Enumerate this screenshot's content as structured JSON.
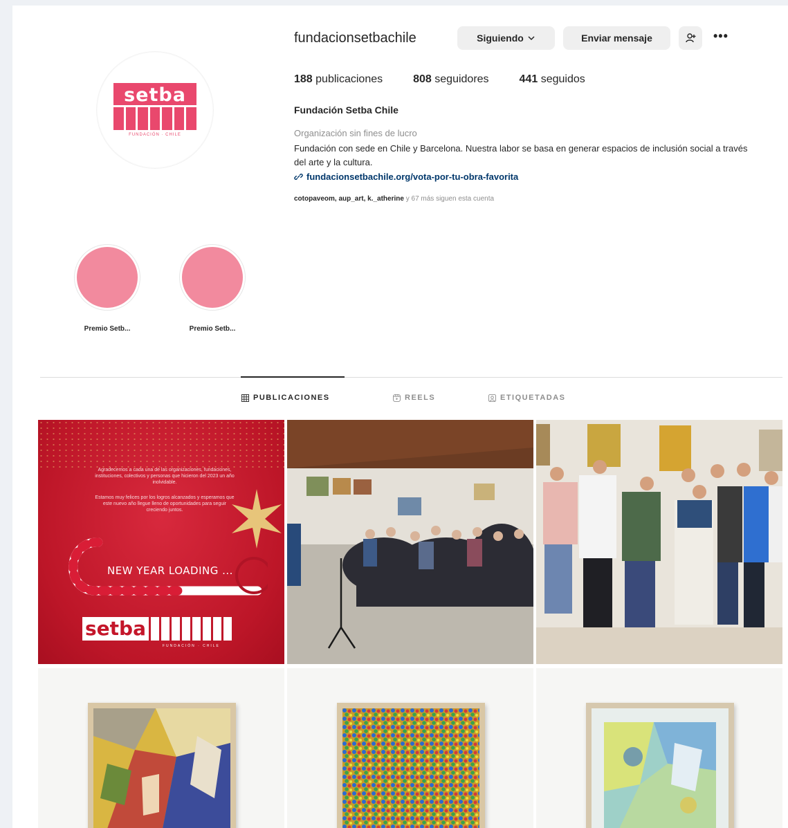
{
  "profile": {
    "username": "fundacionsetbachile",
    "following_button": "Siguiendo",
    "message_button": "Enviar mensaje",
    "stats": [
      {
        "count": "188",
        "label": "publicaciones"
      },
      {
        "count": "808",
        "label": "seguidores"
      },
      {
        "count": "441",
        "label": "seguidos"
      }
    ],
    "full_name": "Fundación Setba Chile",
    "category": "Organización sin fines de lucro",
    "bio": "Fundación con sede en Chile y Barcelona. Nuestra labor se basa en generar espacios de inclusión social a través del arte y la cultura.",
    "link": "fundacionsetbachile.org/vota-por-tu-obra-favorita",
    "followed_by_names": "cotopaveom, aup_art, k._atherine",
    "followed_by_rest": "y 67 más siguen esta cuenta",
    "logo_word": "setba",
    "logo_tagline": "FUNDACIÓN · CHILE"
  },
  "highlights": [
    {
      "label": "Premio Setb..."
    },
    {
      "label": "Premio Setb..."
    }
  ],
  "tabs": [
    {
      "label": "PUBLICACIONES",
      "active": true
    },
    {
      "label": "REELS",
      "active": false
    },
    {
      "label": "ETIQUETADAS",
      "active": false
    }
  ],
  "posts": {
    "post1": {
      "text_block_1": "Agradecemos a cada una de las organizaciones, fundaciones, instituciones, colectivos y personas que hicieron del 2023 un año inolvidable.",
      "text_block_2": "Estamos muy felices por los logros alcanzados y esperamos que este nuevo año llegue lleno de oportunidades para seguir creciendo juntos.",
      "headline": "NEW YEAR LOADING ...",
      "logo_word": "setba",
      "logo_tagline": "FUNDACIÓN · CHILE"
    }
  },
  "colors": {
    "brand_pink": "#e9486d",
    "highlight_pink": "#f28a9e",
    "link_blue": "#00376b",
    "post_red": "#c4162a"
  }
}
